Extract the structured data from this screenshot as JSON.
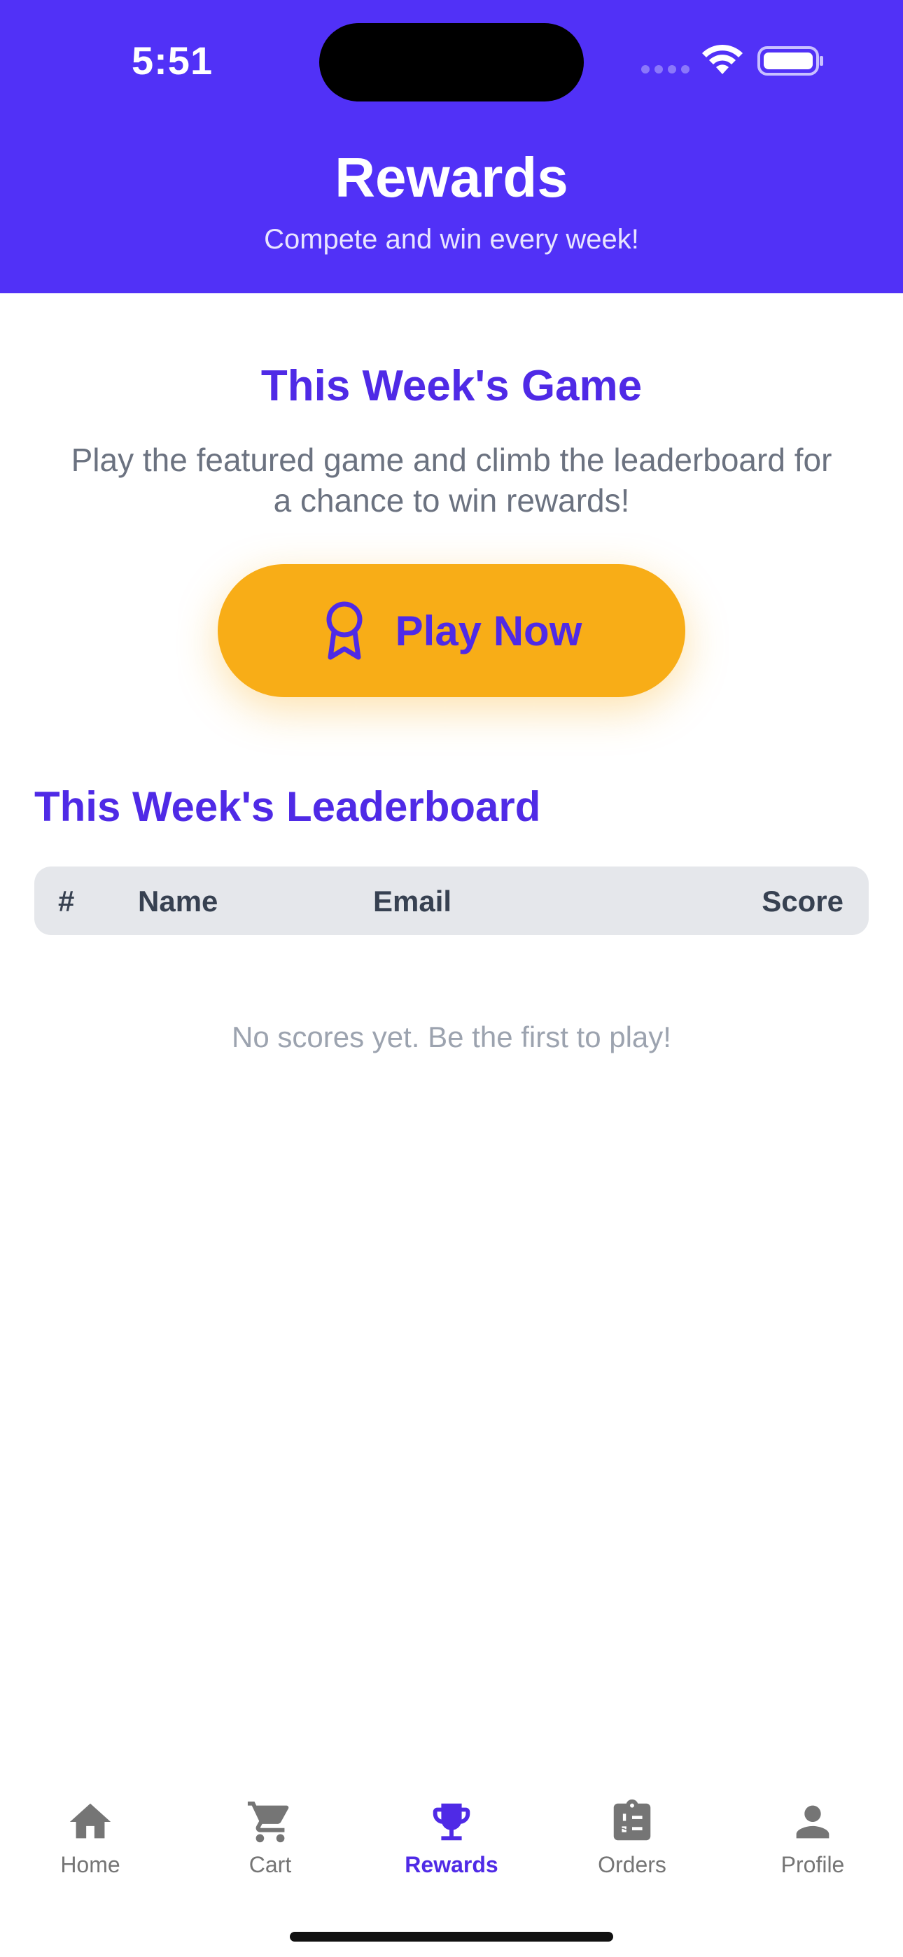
{
  "status_bar": {
    "time": "5:51"
  },
  "header": {
    "title": "Rewards",
    "subtitle": "Compete and win every week!"
  },
  "game": {
    "title": "This Week's Game",
    "description": "Play the featured game and climb the leaderboard for a chance to win rewards!",
    "play_button_label": "Play Now"
  },
  "leaderboard": {
    "title": "This Week's Leaderboard",
    "columns": [
      "#",
      "Name",
      "Email",
      "Score"
    ],
    "rows": [],
    "empty_message": "No scores yet. Be the first to play!"
  },
  "tabs": [
    {
      "label": "Home",
      "icon": "home-icon"
    },
    {
      "label": "Cart",
      "icon": "cart-icon"
    },
    {
      "label": "Rewards",
      "icon": "trophy-icon",
      "active": true
    },
    {
      "label": "Orders",
      "icon": "clipboard-list-icon"
    },
    {
      "label": "Profile",
      "icon": "person-icon"
    }
  ],
  "colors": {
    "primary": "#5131f7",
    "accent": "#f8ad17",
    "heading": "#4f2ae6",
    "muted_text": "#6b7280",
    "tab_inactive": "#757575"
  }
}
